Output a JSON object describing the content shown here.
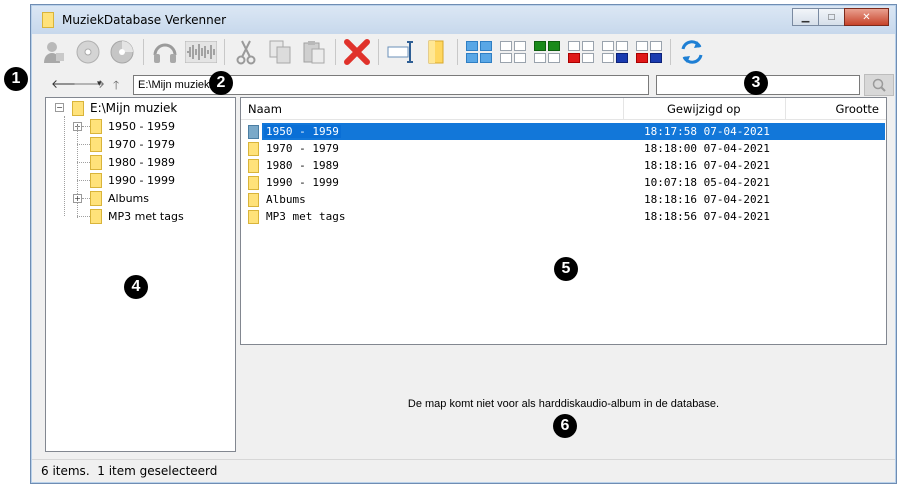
{
  "window": {
    "title": "MuziekDatabase Verkenner"
  },
  "toolbar": {
    "buttons": [
      {
        "name": "user-icon"
      },
      {
        "name": "disc-icon"
      },
      {
        "name": "cd-icon"
      },
      {
        "name": "headphones-icon"
      },
      {
        "name": "waveform-icon"
      },
      {
        "name": "cut-icon"
      },
      {
        "name": "copy-icon"
      },
      {
        "name": "paste-icon"
      },
      {
        "name": "delete-icon"
      },
      {
        "name": "rename-icon"
      },
      {
        "name": "new-folder-icon"
      },
      {
        "name": "view-large-icon"
      },
      {
        "name": "view-small-icon"
      },
      {
        "name": "view-green-icon"
      },
      {
        "name": "view-red-icon"
      },
      {
        "name": "view-blue-icon"
      },
      {
        "name": "view-redblue-icon"
      },
      {
        "name": "refresh-icon"
      }
    ],
    "colors": {
      "delete": "#e0322b",
      "refresh": "#1e7fd4",
      "accent_blue": "#59a7e6",
      "green": "#1a8a1a",
      "red": "#e01818",
      "navy": "#1a3bb0"
    }
  },
  "navigation": {
    "back": "🡐",
    "forward": "🡒",
    "dropdown": "▾",
    "up": "🡑",
    "address_value": "E:\\Mijn muziek",
    "search_value": ""
  },
  "tree": {
    "root": "E:\\Mijn muziek",
    "root_expander": "−",
    "children": [
      {
        "label": "1950 - 1959",
        "expander": "+"
      },
      {
        "label": "1970 - 1979"
      },
      {
        "label": "1980 - 1989"
      },
      {
        "label": "1990 - 1999"
      },
      {
        "label": "Albums",
        "expander": "+"
      },
      {
        "label": "MP3 met tags"
      }
    ]
  },
  "list": {
    "columns": {
      "name": "Naam",
      "modified": "Gewijzigd op",
      "size": "Grootte"
    },
    "rows": [
      {
        "name": "1950 - 1959",
        "modified": "18:17:58 07-04-2021",
        "selected": true
      },
      {
        "name": "1970 - 1979",
        "modified": "18:18:00 07-04-2021"
      },
      {
        "name": "1980 - 1989",
        "modified": "18:18:16 07-04-2021"
      },
      {
        "name": "1990 - 1999",
        "modified": "10:07:18 05-04-2021"
      },
      {
        "name": "Albums",
        "modified": "18:18:16 07-04-2021"
      },
      {
        "name": "MP3 met tags",
        "modified": "18:18:56 07-04-2021"
      }
    ],
    "selection_color": "#1277d9"
  },
  "info_message": "De map komt niet voor als harddiskaudio-album in de database.",
  "status_bar": {
    "text": "6 items.  1 item geselecteerd"
  },
  "callouts": [
    "1",
    "2",
    "3",
    "4",
    "5",
    "6"
  ]
}
